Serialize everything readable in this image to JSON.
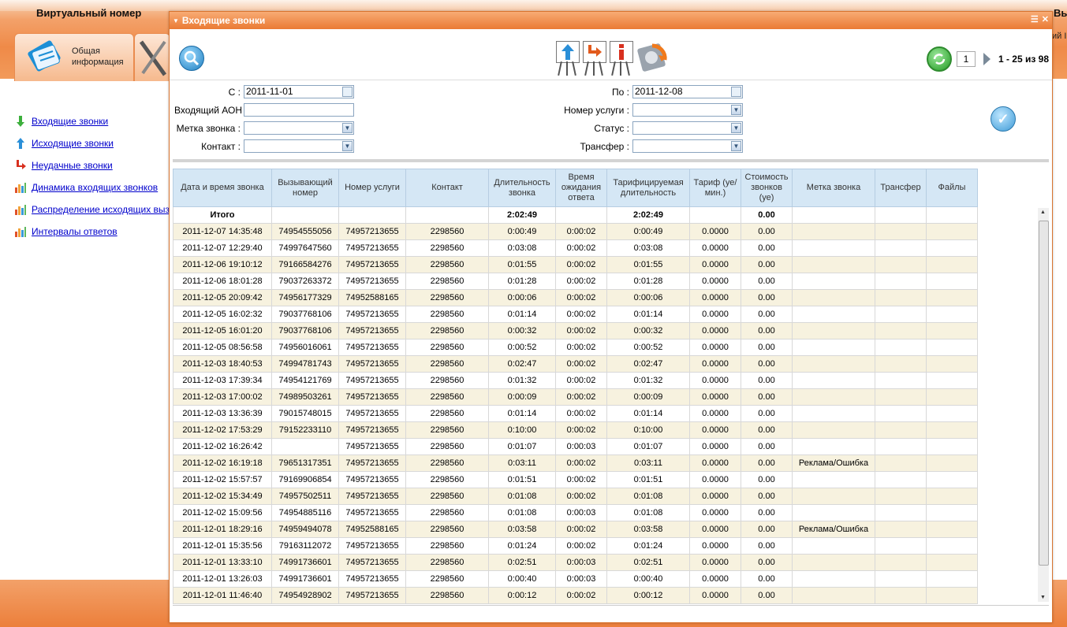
{
  "app": {
    "title": "Виртуальный номер",
    "right_label": "Выход",
    "right_sub": "ий I",
    "tab_general": "Общая информация"
  },
  "side_menu": [
    {
      "label": "Входящие звонки",
      "icon": "arrow-down-green-icon"
    },
    {
      "label": "Исходящие звонки",
      "icon": "arrow-up-blue-icon"
    },
    {
      "label": "Неудачные звонки",
      "icon": "arrow-turn-red-icon"
    },
    {
      "label": "Динамика входящих звонков",
      "icon": "bar-chart-icon"
    },
    {
      "label": "Распределение исходящих вызов",
      "icon": "bar-chart-icon"
    },
    {
      "label": "Интервалы ответов",
      "icon": "bar-chart-icon"
    }
  ],
  "dialog": {
    "title": "Входящие звонки",
    "pager": {
      "page": "1",
      "range": "1 - 25 из 98"
    }
  },
  "filters": {
    "from_label": "С :",
    "from_value": "2011-11-01",
    "to_label": "По :",
    "to_value": "2011-12-08",
    "aon_label": "Входящий АОН :",
    "aon_value": "",
    "service_label": "Номер услуги :",
    "service_value": "",
    "tag_label": "Метка звонка :",
    "tag_value": "",
    "status_label": "Статус :",
    "status_value": "",
    "contact_label": "Контакт :",
    "contact_value": "",
    "transfer_label": "Трансфер :",
    "transfer_value": ""
  },
  "grid": {
    "columns": [
      "Дата и время звонка",
      "Вызывающий номер",
      "Номер услуги",
      "Контакт",
      "Длительность звонка",
      "Время ожидания ответа",
      "Тарифицируемая длительность",
      "Тариф (уе/мин.)",
      "Стоимость звонков (уе)",
      "Метка звонка",
      "Трансфер",
      "Файлы"
    ],
    "total": [
      "Итого",
      "",
      "",
      "",
      "2:02:49",
      "",
      "2:02:49",
      "",
      "0.00",
      "",
      "",
      ""
    ],
    "rows": [
      [
        "2011-12-07 14:35:48",
        "74954555056",
        "74957213655",
        "2298560",
        "0:00:49",
        "0:00:02",
        "0:00:49",
        "0.0000",
        "0.00",
        "",
        "",
        ""
      ],
      [
        "2011-12-07 12:29:40",
        "74997647560",
        "74957213655",
        "2298560",
        "0:03:08",
        "0:00:02",
        "0:03:08",
        "0.0000",
        "0.00",
        "",
        "",
        ""
      ],
      [
        "2011-12-06 19:10:12",
        "79166584276",
        "74957213655",
        "2298560",
        "0:01:55",
        "0:00:02",
        "0:01:55",
        "0.0000",
        "0.00",
        "",
        "",
        ""
      ],
      [
        "2011-12-06 18:01:28",
        "79037263372",
        "74957213655",
        "2298560",
        "0:01:28",
        "0:00:02",
        "0:01:28",
        "0.0000",
        "0.00",
        "",
        "",
        ""
      ],
      [
        "2011-12-05 20:09:42",
        "74956177329",
        "74952588165",
        "2298560",
        "0:00:06",
        "0:00:02",
        "0:00:06",
        "0.0000",
        "0.00",
        "",
        "",
        ""
      ],
      [
        "2011-12-05 16:02:32",
        "79037768106",
        "74957213655",
        "2298560",
        "0:01:14",
        "0:00:02",
        "0:01:14",
        "0.0000",
        "0.00",
        "",
        "",
        ""
      ],
      [
        "2011-12-05 16:01:20",
        "79037768106",
        "74957213655",
        "2298560",
        "0:00:32",
        "0:00:02",
        "0:00:32",
        "0.0000",
        "0.00",
        "",
        "",
        ""
      ],
      [
        "2011-12-05 08:56:58",
        "74956016061",
        "74957213655",
        "2298560",
        "0:00:52",
        "0:00:02",
        "0:00:52",
        "0.0000",
        "0.00",
        "",
        "",
        ""
      ],
      [
        "2011-12-03 18:40:53",
        "74994781743",
        "74957213655",
        "2298560",
        "0:02:47",
        "0:00:02",
        "0:02:47",
        "0.0000",
        "0.00",
        "",
        "",
        ""
      ],
      [
        "2011-12-03 17:39:34",
        "74954121769",
        "74957213655",
        "2298560",
        "0:01:32",
        "0:00:02",
        "0:01:32",
        "0.0000",
        "0.00",
        "",
        "",
        ""
      ],
      [
        "2011-12-03 17:00:02",
        "74989503261",
        "74957213655",
        "2298560",
        "0:00:09",
        "0:00:02",
        "0:00:09",
        "0.0000",
        "0.00",
        "",
        "",
        ""
      ],
      [
        "2011-12-03 13:36:39",
        "79015748015",
        "74957213655",
        "2298560",
        "0:01:14",
        "0:00:02",
        "0:01:14",
        "0.0000",
        "0.00",
        "",
        "",
        ""
      ],
      [
        "2011-12-02 17:53:29",
        "79152233110",
        "74957213655",
        "2298560",
        "0:10:00",
        "0:00:02",
        "0:10:00",
        "0.0000",
        "0.00",
        "",
        "",
        ""
      ],
      [
        "2011-12-02 16:26:42",
        "",
        "74957213655",
        "2298560",
        "0:01:07",
        "0:00:03",
        "0:01:07",
        "0.0000",
        "0.00",
        "",
        "",
        ""
      ],
      [
        "2011-12-02 16:19:18",
        "79651317351",
        "74957213655",
        "2298560",
        "0:03:11",
        "0:00:02",
        "0:03:11",
        "0.0000",
        "0.00",
        "Реклама/Ошибка",
        "",
        ""
      ],
      [
        "2011-12-02 15:57:57",
        "79169906854",
        "74957213655",
        "2298560",
        "0:01:51",
        "0:00:02",
        "0:01:51",
        "0.0000",
        "0.00",
        "",
        "",
        ""
      ],
      [
        "2011-12-02 15:34:49",
        "74957502511",
        "74957213655",
        "2298560",
        "0:01:08",
        "0:00:02",
        "0:01:08",
        "0.0000",
        "0.00",
        "",
        "",
        ""
      ],
      [
        "2011-12-02 15:09:56",
        "74954885116",
        "74957213655",
        "2298560",
        "0:01:08",
        "0:00:03",
        "0:01:08",
        "0.0000",
        "0.00",
        "",
        "",
        ""
      ],
      [
        "2011-12-01 18:29:16",
        "74959494078",
        "74952588165",
        "2298560",
        "0:03:58",
        "0:00:02",
        "0:03:58",
        "0.0000",
        "0.00",
        "Реклама/Ошибка",
        "",
        ""
      ],
      [
        "2011-12-01 15:35:56",
        "79163112072",
        "74957213655",
        "2298560",
        "0:01:24",
        "0:00:02",
        "0:01:24",
        "0.0000",
        "0.00",
        "",
        "",
        ""
      ],
      [
        "2011-12-01 13:33:10",
        "74991736601",
        "74957213655",
        "2298560",
        "0:02:51",
        "0:00:03",
        "0:02:51",
        "0.0000",
        "0.00",
        "",
        "",
        ""
      ],
      [
        "2011-12-01 13:26:03",
        "74991736601",
        "74957213655",
        "2298560",
        "0:00:40",
        "0:00:03",
        "0:00:40",
        "0.0000",
        "0.00",
        "",
        "",
        ""
      ],
      [
        "2011-12-01 11:46:40",
        "74954928902",
        "74957213655",
        "2298560",
        "0:00:12",
        "0:00:02",
        "0:00:12",
        "0.0000",
        "0.00",
        "",
        "",
        ""
      ]
    ]
  }
}
